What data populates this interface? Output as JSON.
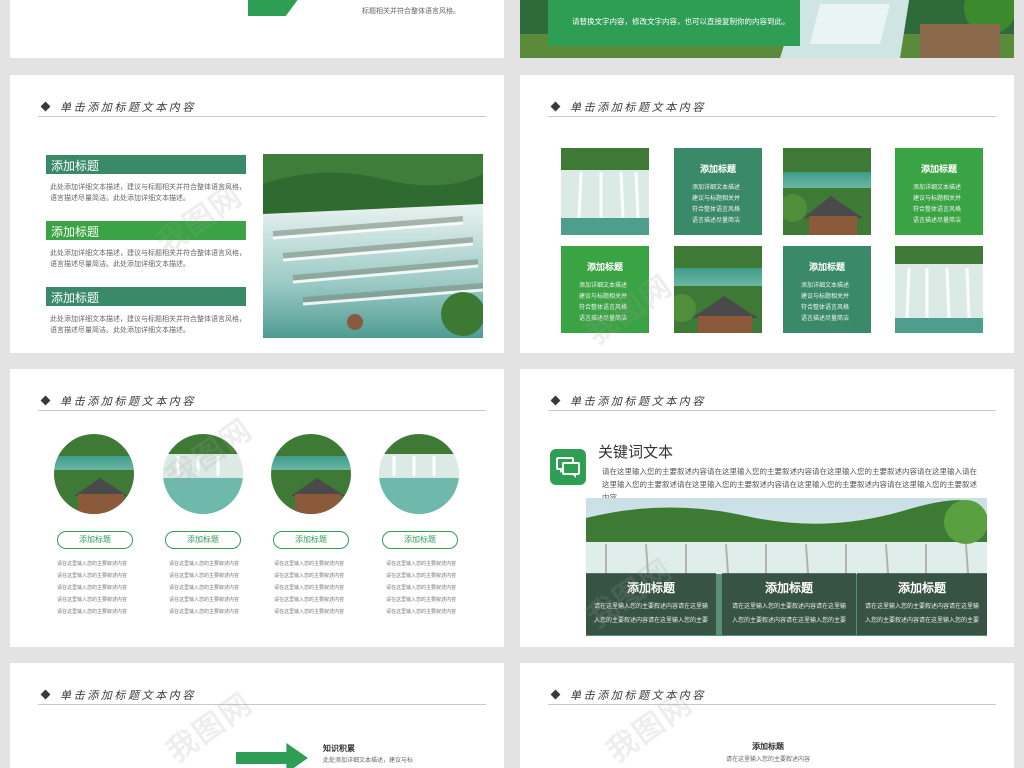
{
  "colors": {
    "green_dark": "#3a8a6a",
    "green": "#2e9e54",
    "green_bright": "#3aa343"
  },
  "slide1": {
    "text_lines": [
      "标题相关并符合整体语言风格。"
    ]
  },
  "slide2": {
    "text": "请替换文字内容，修改文字内容，也可以直接复制你的内容到此。"
  },
  "slide3": {
    "title": "单击添加标题文本内容",
    "items": [
      {
        "heading": "添加标题",
        "body": "此处添加详细文本描述，建议与标题相关并符合整体语言风格，语言描述尽量简洁。此处添加详细文本描述。"
      },
      {
        "heading": "添加标题",
        "body": "此处添加详细文本描述，建议与标题相关并符合整体语言风格，语言描述尽量简洁。此处添加详细文本描述。"
      },
      {
        "heading": "添加标题",
        "body": "此处添加详细文本描述，建议与标题相关并符合整体语言风格，语言描述尽量简洁。此处添加详细文本描述。"
      }
    ]
  },
  "slide4": {
    "title": "单击添加标题文本内容",
    "tiles": [
      {
        "heading": "添加标题",
        "lines": [
          "添加详细文本描述",
          "建议与标题相关并",
          "符合整体语言风格",
          "语言描述尽量简洁"
        ]
      },
      {
        "heading": "添加标题",
        "lines": [
          "添加详细文本描述",
          "建议与标题相关并",
          "符合整体语言风格",
          "语言描述尽量简洁"
        ]
      },
      {
        "heading": "添加标题",
        "lines": [
          "添加详细文本描述",
          "建议与标题相关并",
          "符合整体语言风格",
          "语言描述尽量简洁"
        ]
      },
      {
        "heading": "添加标题",
        "lines": [
          "添加详细文本描述",
          "建议与标题相关并",
          "符合整体语言风格",
          "语言描述尽量简洁"
        ]
      }
    ]
  },
  "slide5": {
    "title": "单击添加标题文本内容",
    "items": [
      {
        "pill": "添加标题",
        "lines": [
          "请在这里输入您的主要叙述内容",
          "请在这里输入您的主要叙述内容",
          "请在这里输入您的主要叙述内容",
          "请在这里输入您的主要叙述内容",
          "请在这里输入您的主要叙述内容"
        ]
      },
      {
        "pill": "添加标题",
        "lines": [
          "请在这里输入您的主要叙述内容",
          "请在这里输入您的主要叙述内容",
          "请在这里输入您的主要叙述内容",
          "请在这里输入您的主要叙述内容",
          "请在这里输入您的主要叙述内容"
        ]
      },
      {
        "pill": "添加标题",
        "lines": [
          "请在这里输入您的主要叙述内容",
          "请在这里输入您的主要叙述内容",
          "请在这里输入您的主要叙述内容",
          "请在这里输入您的主要叙述内容",
          "请在这里输入您的主要叙述内容"
        ]
      },
      {
        "pill": "添加标题",
        "lines": [
          "请在这里输入您的主要叙述内容",
          "请在这里输入您的主要叙述内容",
          "请在这里输入您的主要叙述内容",
          "请在这里输入您的主要叙述内容",
          "请在这里输入您的主要叙述内容"
        ]
      }
    ]
  },
  "slide6": {
    "title": "单击添加标题文本内容",
    "kw_title": "关键词文本",
    "kw_body": "请在这里输入您的主要叙述内容请在这里输入您的主要叙述内容请在这里输入您的主要叙述内容请在这里输入请在这里输入您的主要叙述请在这里输入您的主要叙述内容请在这里输入您的主要叙述内容请在这里输入您的主要叙述内容",
    "overlays": [
      {
        "heading": "添加标题",
        "lines": [
          "请在这里输入您的主要叙述内容请在这里输",
          "入您的主要叙述内容请在这里输入您的主要"
        ]
      },
      {
        "heading": "添加标题",
        "lines": [
          "请在这里输入您的主要叙述内容请在这里输",
          "入您的主要叙述内容请在这里输入您的主要"
        ]
      },
      {
        "heading": "添加标题",
        "lines": [
          "请在这里输入您的主要叙述内容请在这里输",
          "入您的主要叙述内容请在这里输入您的主要"
        ]
      }
    ]
  },
  "slide7": {
    "title": "单击添加标题文本内容",
    "heading": "知识积累",
    "body": "此处添加详细文本描述，建议与标"
  },
  "slide8": {
    "title": "单击添加标题文本内容",
    "heading": "添加标题",
    "body": "请在这里输入您的主要叙述内容"
  },
  "watermark": "我图网"
}
